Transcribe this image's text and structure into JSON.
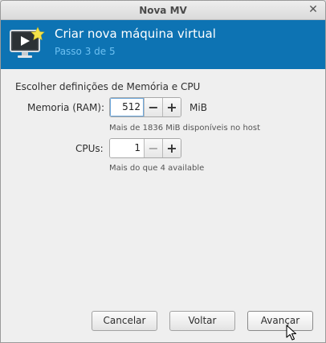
{
  "window": {
    "title": "Nova MV"
  },
  "banner": {
    "heading": "Criar nova máquina virtual",
    "step": "Passo 3 de 5",
    "icon": "vm-new-icon"
  },
  "section_label": "Escolher definições de Memória e CPU",
  "memory": {
    "label": "Memoria (RAM):",
    "value": "512",
    "unit": "MiB",
    "hint": "Mais de 1836 MiB disponíveis no host"
  },
  "cpus": {
    "label": "CPUs:",
    "value": "1",
    "hint": "Mais do que 4 available"
  },
  "buttons": {
    "cancel": "Cancelar",
    "back": "Voltar",
    "forward": "Avançar"
  },
  "colors": {
    "banner": "#0d73b3",
    "step_text": "#6cc0f2"
  }
}
